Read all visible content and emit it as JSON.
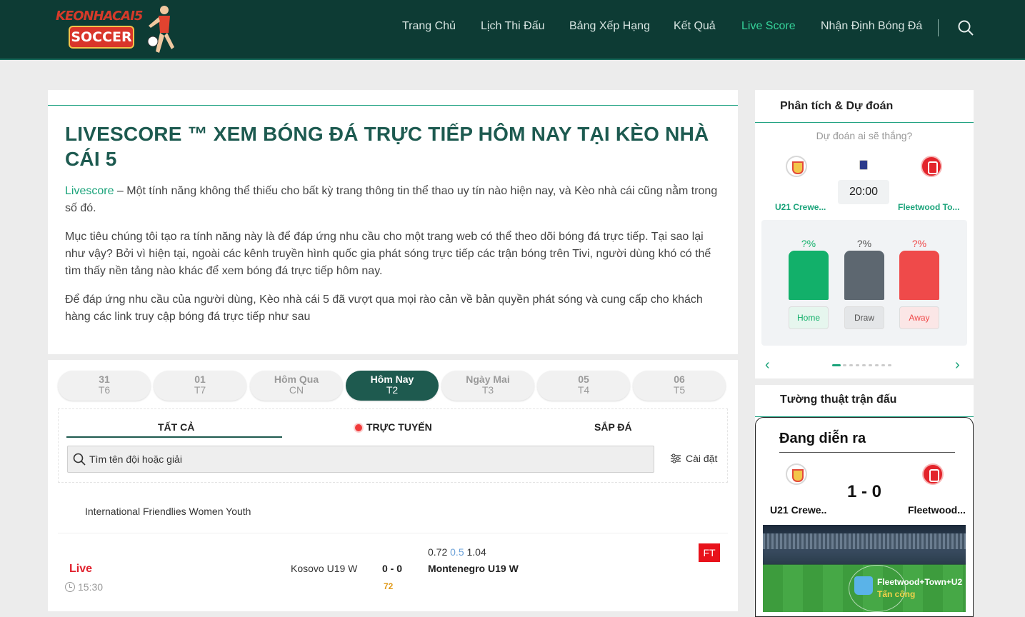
{
  "header": {
    "logo_top": "KEONHACAI5",
    "logo_bottom": "SOCCER",
    "nav": [
      "Trang Chủ",
      "Lịch Thi Đấu",
      "Bảng Xếp Hạng",
      "Kết Quả",
      "Live Score",
      "Nhận Định Bóng Đá"
    ],
    "active_nav": "Live Score",
    "accent": "#36d39a",
    "bg": "#0d3b34"
  },
  "article": {
    "title": "LIVESCORE ™ XEM BÓNG ĐÁ TRỰC TIẾP HÔM NAY TẠI KÈO NHÀ CÁI 5",
    "p1_link": "Livescore",
    "p1_text": " – Một tính năng không thể thiếu cho bất kỳ trang thông tin thể thao uy tín nào hiện nay, và Kèo nhà cái  cũng nằm trong số đó.",
    "p2": "Mục tiêu chúng tôi tạo ra tính năng này là để đáp ứng nhu cầu cho một trang web có thể theo dõi bóng đá trực tiếp. Tại sao lại như vậy? Bởi vì hiện tại, ngoài các kênh truyền hình quốc gia phát sóng trực tiếp các trận bóng trên Tivi, người dùng khó có thể tìm thấy nền tảng nào khác để xem bóng đá trực tiếp hôm nay.",
    "p3": "Để đáp ứng nhu cầu của người dùng, Kèo nhà cái 5 đã vượt qua mọi rào cản về bản quyền phát sóng và cung cấp cho khách hàng các link truy cập bóng đá trực tiếp như sau"
  },
  "schedule": {
    "days": [
      {
        "top": "31",
        "sub": "T6"
      },
      {
        "top": "01",
        "sub": "T7"
      },
      {
        "top": "Hôm Qua",
        "sub": "CN"
      },
      {
        "top": "Hôm Nay",
        "sub": "T2"
      },
      {
        "top": "Ngày Mai",
        "sub": "T3"
      },
      {
        "top": "05",
        "sub": "T4"
      },
      {
        "top": "06",
        "sub": "T5"
      }
    ],
    "filters": {
      "all": "TẤT CẢ",
      "live": "TRỰC TUYẾN",
      "upcoming": "SẮP ĐÁ"
    },
    "search_placeholder": "Tìm tên đội hoặc giải",
    "settings": "Cài đặt",
    "league": "International Friendlies Women Youth",
    "match": {
      "status": "Live",
      "time": "15:30",
      "home": "Kosovo U19 W",
      "score": "0 - 0",
      "minute": "72",
      "odds_home": "0.72",
      "odds_line": "0.5",
      "odds_away": "1.04",
      "away": "Montenegro U19 W",
      "badge": "FT"
    }
  },
  "prediction": {
    "title": "Phân tích & Dự đoán",
    "question": "Dự đoán ai sẽ thắng?",
    "time": "20:00",
    "home": "U21 Crewe...",
    "away": "Fleetwood To...",
    "home_pct": "?%",
    "draw_pct": "?%",
    "away_pct": "?%",
    "home_btn": "Home",
    "draw_btn": "Draw",
    "away_btn": "Away",
    "colors": {
      "home": "#12b06a",
      "draw": "#5d6770",
      "away": "#ef4a4a"
    }
  },
  "commentary": {
    "title": "Tường thuật trận đấu",
    "status": "Đang diễn ra",
    "score": "1 - 0",
    "home": "U21 Crewe..",
    "away": "Fleetwood...",
    "event_team": "Fleetwood+Town+U2",
    "event_action": "Tấn công"
  }
}
